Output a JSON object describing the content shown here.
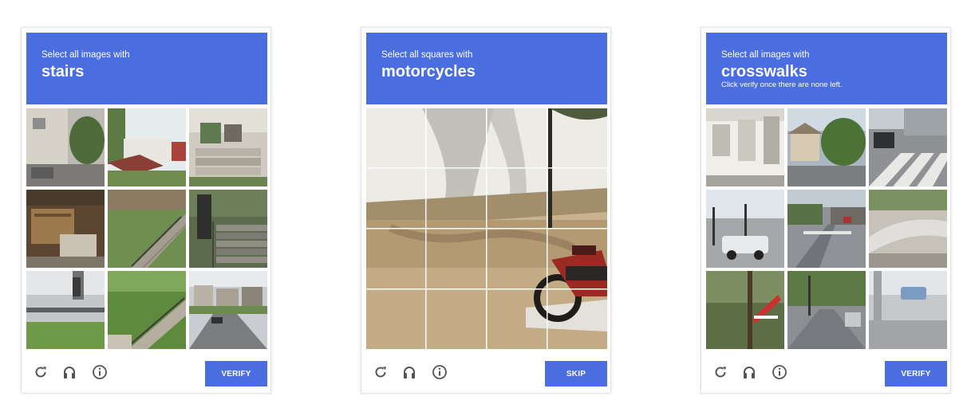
{
  "captchas": [
    {
      "instruction": "Select all images with",
      "target": "stairs",
      "note": "",
      "button": "VERIFY",
      "tiles": [
        "building wall with tree",
        "house with red roof",
        "porch stairs with chairs",
        "wooden crates",
        "outdoor stairs with railing",
        "concrete stairs",
        "pedestrian on sidewalk",
        "garden stairs",
        "suburban street with houses"
      ]
    },
    {
      "instruction": "Select all squares with",
      "target": "motorcycles",
      "note": "",
      "button": "SKIP",
      "grid_size": 4,
      "scene": "parked motorcycle by a wall with tree shadow"
    },
    {
      "instruction": "Select all images with",
      "target": "crosswalks",
      "note": "Click verify once there are none left.",
      "button": "VERIFY",
      "tiles": [
        "white building facade",
        "house and trees",
        "street crossing",
        "parking lot with SUV",
        "road intersection",
        "curving road",
        "tree and railing",
        "road with car",
        "parked car near building"
      ]
    }
  ],
  "colors": {
    "accent": "#4a6ee0",
    "icon": "#555555"
  },
  "footer_icons": [
    "reload-icon",
    "audio-icon",
    "info-icon"
  ]
}
